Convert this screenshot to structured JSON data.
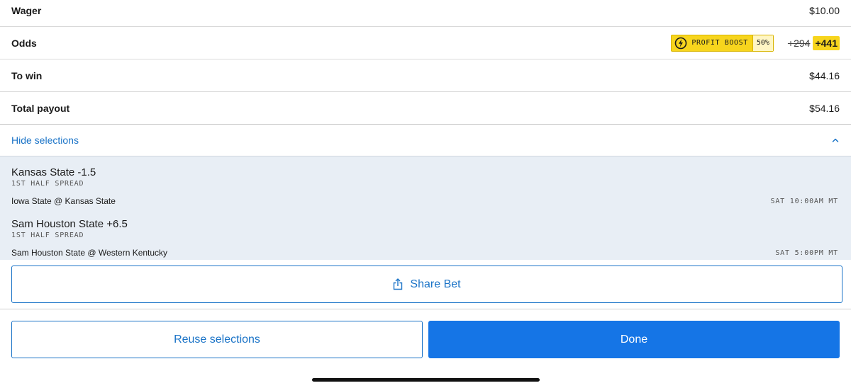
{
  "summary": {
    "wager_label": "Wager",
    "wager_value": "$10.00",
    "odds_label": "Odds",
    "boost_label": "PROFIT BOOST",
    "boost_percent": "50%",
    "odds_original": "+294",
    "odds_boosted": "+441",
    "to_win_label": "To win",
    "to_win_value": "$44.16",
    "total_payout_label": "Total payout",
    "total_payout_value": "$54.16",
    "hide_selections_label": "Hide selections"
  },
  "selections": [
    {
      "team": "Kansas State -1.5",
      "market": "1ST HALF SPREAD",
      "matchup": "Iowa State @ Kansas State",
      "time": "SAT 10:00AM MT"
    },
    {
      "team": "Sam Houston State +6.5",
      "market": "1ST HALF SPREAD",
      "matchup": "Sam Houston State @ Western Kentucky",
      "time": "SAT 5:00PM MT"
    }
  ],
  "actions": {
    "share_label": "Share Bet",
    "reuse_label": "Reuse selections",
    "done_label": "Done"
  },
  "icons": {
    "boost": "lightning-bolt-icon",
    "collapse": "chevron-up-icon",
    "share": "share-icon"
  },
  "colors": {
    "accent": "#1a73c7",
    "primary_button": "#1575e6",
    "boost_yellow": "#f7d51d",
    "selection_bg": "#e8eef5"
  }
}
